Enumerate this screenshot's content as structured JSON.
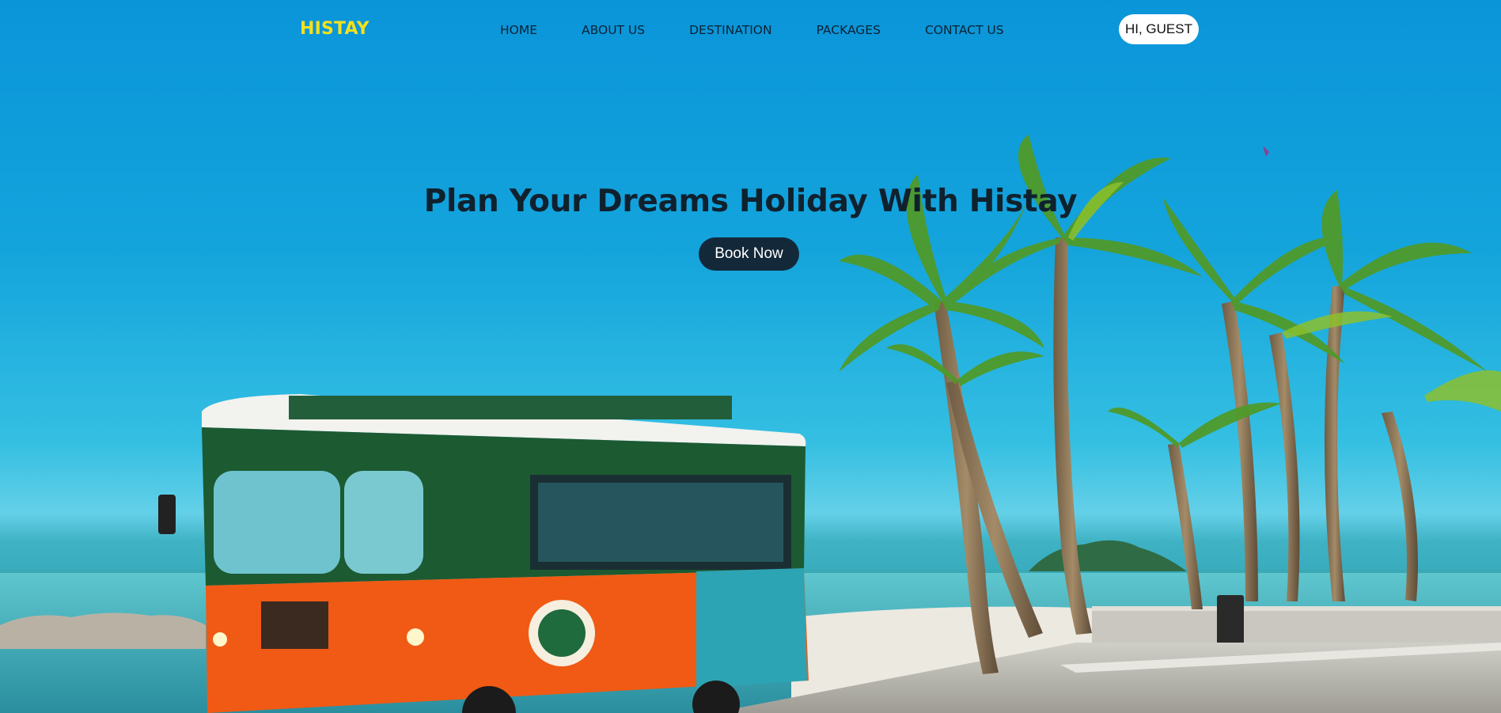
{
  "brand": {
    "logo": "HISTAY"
  },
  "nav": {
    "items": [
      "HOME",
      "ABOUT US",
      "DESTINATION",
      "PACKAGES",
      "CONTACT US"
    ]
  },
  "user": {
    "greeting": "HI, GUEST"
  },
  "hero": {
    "headline": "Plan Your Dreams Holiday With Histay",
    "cta": "Book Now"
  },
  "colors": {
    "logo": "#f4e11c",
    "sky": "#0a95d9",
    "cta_bg": "#13293a",
    "trolley_orange": "#f05a14",
    "trolley_green": "#1c5a32"
  }
}
